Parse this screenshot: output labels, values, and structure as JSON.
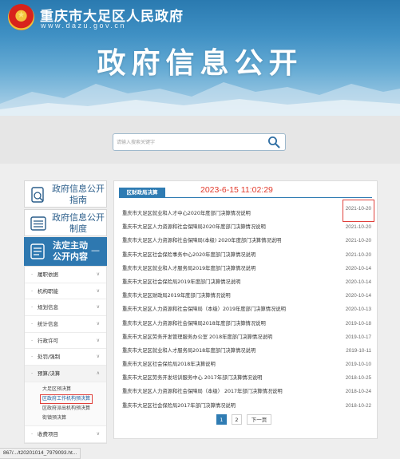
{
  "header": {
    "site_name": "重庆市大足区人民政府",
    "site_url": "www.dazu.gov.cn",
    "banner_title": "政府信息公开"
  },
  "search": {
    "placeholder": "请输入搜索关键字"
  },
  "sidebar": {
    "blocks": [
      {
        "label": "政府信息公开指南",
        "icon": "guide-icon"
      },
      {
        "label": "政府信息公开制度",
        "icon": "list-icon"
      }
    ],
    "main": {
      "label": "法定主动公开内容",
      "icon": "document-icon",
      "toggle": "—"
    },
    "menu": [
      {
        "label": "履职依据"
      },
      {
        "label": "机构职能"
      },
      {
        "label": "规划信息"
      },
      {
        "label": "统计信息"
      },
      {
        "label": "行政许可"
      },
      {
        "label": "处罚/强制"
      },
      {
        "label": "预算/决算"
      },
      {
        "label": "收费项目"
      }
    ],
    "sub_menu": [
      {
        "label": "大足区预决算"
      },
      {
        "label": "区政府工作机构预决算"
      },
      {
        "label": "区政府派出机构预决算"
      },
      {
        "label": "街镇预决算"
      }
    ]
  },
  "panel": {
    "tab_label": "区财政局决算",
    "timestamp": "2023-6-15 11:02:29",
    "items": [
      {
        "title": "重庆市大足区就业和人才中心2020年度部门决算情况说明",
        "date": "2021-10-20"
      },
      {
        "title": "重庆市大足区人力资源和社会保障局2020年度部门决算情况说明",
        "date": "2021-10-20"
      },
      {
        "title": "重庆市大足区人力资源和社会保障局(本级) 2020年度部门决算情况说明",
        "date": "2021-10-20"
      },
      {
        "title": "重庆市大足区社会保险事务中心2020年度部门决算情况说明",
        "date": "2021-10-20"
      },
      {
        "title": "重庆市大足区就业和人才服务局2019年度部门决算情况说明",
        "date": "2020-10-14"
      },
      {
        "title": "重庆市大足区社会保险局2019年度部门决算情况说明",
        "date": "2020-10-14"
      },
      {
        "title": "重庆市大足区财政局2019年度部门决算情况说明",
        "date": "2020-10-14"
      },
      {
        "title": "重庆市大足区人力资源和社会保障局（本级）2019年度部门决算情况说明",
        "date": "2020-10-13"
      },
      {
        "title": "重庆市大足区人力资源和社会保障局2018年度部门决算情况说明",
        "date": "2019-10-18"
      },
      {
        "title": "重庆市大足区劳务开发管理服务办公室 2018年度部门决算情况说明",
        "date": "2019-10-17"
      },
      {
        "title": "重庆市大足区就业和人才服务局2018年度部门决算情况说明",
        "date": "2019-10-11"
      },
      {
        "title": "重庆市大足区社会保险局2018年决算说明",
        "date": "2019-10-10"
      },
      {
        "title": "重庆市大足区劳务开发培训服务中心 2017年部门决算情况说明",
        "date": "2018-10-25"
      },
      {
        "title": "重庆市大足区人力资源和社会保障局（本级） 2017年部门决算情况说明",
        "date": "2018-10-24"
      },
      {
        "title": "重庆市大足区社会保险局2017年部门决算情况说明",
        "date": "2018-10-22"
      }
    ],
    "pagination": {
      "page1": "1",
      "page2": "2",
      "next": "下一页"
    }
  },
  "status_bar": {
    "text": "867/.../t20201014_7979093.ht..."
  },
  "colors": {
    "brand_blue": "#2e78b0",
    "annotation_red": "#e0413c"
  }
}
